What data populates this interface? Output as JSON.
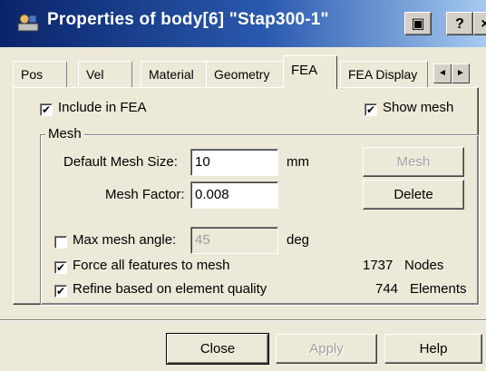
{
  "window": {
    "title": "Properties of body[6] \"Stap300-1\"",
    "icon": "app-icon",
    "controls": {
      "restore": "▣",
      "help": "?",
      "close": "×"
    }
  },
  "tabs": [
    {
      "label": "Pos",
      "active": false
    },
    {
      "label": "Vel",
      "active": false
    },
    {
      "label": "Material",
      "active": false
    },
    {
      "label": "Geometry",
      "active": false
    },
    {
      "label": "FEA",
      "active": true
    },
    {
      "label": "FEA Display",
      "active": false
    }
  ],
  "tab_scroll": {
    "left": "◄",
    "right": "►"
  },
  "fea": {
    "include_label": "Include in FEA",
    "include_checked": true,
    "show_mesh_label": "Show mesh",
    "show_mesh_checked": true,
    "group_title": "Mesh",
    "default_mesh_size_label": "Default Mesh Size:",
    "default_mesh_size_value": "10",
    "default_mesh_size_unit": "mm",
    "mesh_factor_label": "Mesh Factor:",
    "mesh_factor_value": "0.008",
    "mesh_button": "Mesh",
    "delete_button": "Delete",
    "max_angle_label": "Max mesh angle:",
    "max_angle_checked": false,
    "max_angle_value": "45",
    "max_angle_unit": "deg",
    "force_label": "Force all features to mesh",
    "force_checked": true,
    "refine_label": "Refine based on element quality",
    "refine_checked": true,
    "nodes_count": "1737",
    "nodes_label": "Nodes",
    "elements_count": "744",
    "elements_label": "Elements"
  },
  "footer": {
    "close": "Close",
    "apply": "Apply",
    "help": "Help"
  },
  "check_glyph": "✔"
}
